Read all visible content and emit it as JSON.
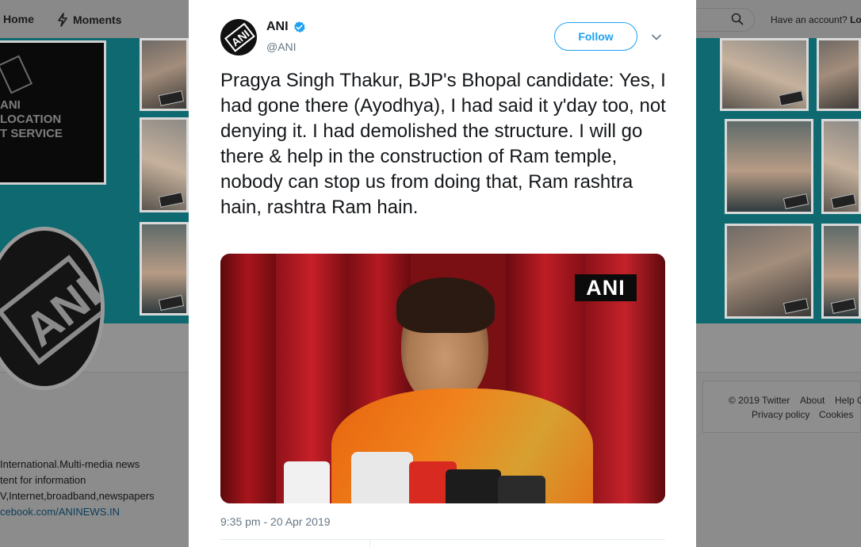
{
  "nav": {
    "home_label": "Home",
    "moments_label": "Moments",
    "have_account": "Have an account?",
    "login_partial": "Lo"
  },
  "banner": {
    "location_card_lines": [
      "ANI",
      "LOCATION",
      "T SERVICE"
    ],
    "tile_badge": "ANI"
  },
  "profile": {
    "bio_lines": [
      " International.Multi-media news",
      "tent for information",
      "V,Internet,broadband,newspapers"
    ],
    "bio_link": "cebook.com/ANINEWS.IN"
  },
  "footer": {
    "copyright": "© 2019 Twitter",
    "about": "About",
    "help_partial": "Help C",
    "privacy": "Privacy policy",
    "cookies": "Cookies"
  },
  "tweet": {
    "name": "ANI",
    "handle": "@ANI",
    "follow_label": "Follow",
    "text": "Pragya Singh Thakur, BJP's Bhopal candidate: Yes, I had gone there (Ayodhya), I had said it y'day too, not denying it. I had demolished the structure. I will go there & help in the construction of Ram temple, nobody can stop us from doing that, Ram rashtra hain, rashtra Ram hain.",
    "media_watermark": "ANI",
    "timestamp": "9:35 pm - 20 Apr 2019"
  },
  "icons": {
    "home": "home-icon",
    "moments": "lightning-icon",
    "search": "search-icon",
    "verified": "verified-badge-icon",
    "caret": "chevron-down-icon"
  },
  "colors": {
    "accent": "#1da1f2",
    "handle_gray": "#657786",
    "banner_teal": "#0e6a70",
    "overlay": "#8c8c8c"
  }
}
